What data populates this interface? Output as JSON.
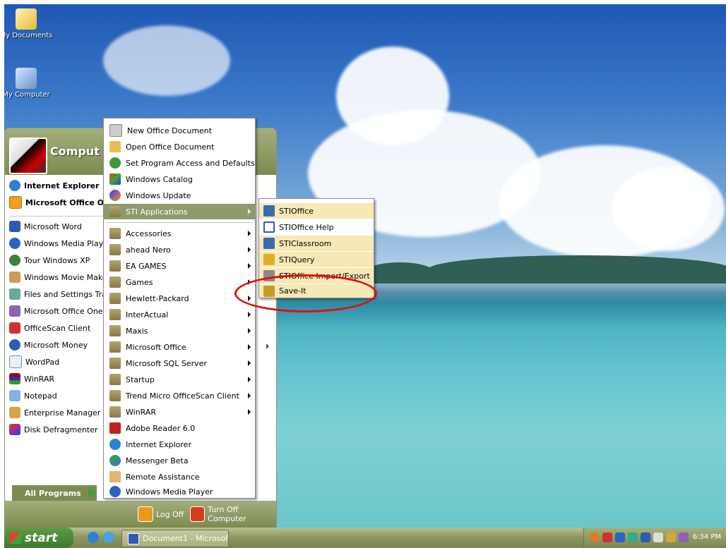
{
  "desktop": {
    "icons": [
      {
        "label": "My Documents",
        "icon": "folder-documents-icon"
      },
      {
        "label": "My Computer",
        "icon": "computer-icon"
      }
    ]
  },
  "start_menu": {
    "user_name": "Comput",
    "pinned": [
      {
        "label": "Internet Explorer",
        "icon": "internet-explorer-icon"
      },
      {
        "label": "Microsoft Office O",
        "icon": "office-icon"
      }
    ],
    "recent": [
      {
        "label": "Microsoft Word",
        "icon": "word-icon"
      },
      {
        "label": "Windows Media Playe",
        "icon": "media-player-icon"
      },
      {
        "label": "Tour Windows XP",
        "icon": "tour-icon"
      },
      {
        "label": "Windows Movie Make",
        "icon": "movie-maker-icon"
      },
      {
        "label": "Files and Settings Tra",
        "icon": "transfer-icon"
      },
      {
        "label": "Microsoft Office One",
        "icon": "onenote-icon"
      },
      {
        "label": "OfficeScan Client",
        "icon": "officescan-icon"
      },
      {
        "label": "Microsoft Money",
        "icon": "money-icon"
      },
      {
        "label": "WordPad",
        "icon": "wordpad-icon"
      },
      {
        "label": "WinRAR",
        "icon": "winrar-icon"
      },
      {
        "label": "Notepad",
        "icon": "notepad-icon"
      },
      {
        "label": "Enterprise Manager",
        "icon": "enterprise-manager-icon"
      },
      {
        "label": "Disk Defragmenter",
        "icon": "defrag-icon"
      }
    ],
    "all_programs": "All Programs",
    "log_off": "Log Off",
    "turn_off": "Turn Off Computer"
  },
  "programs_menu": {
    "top_items": [
      {
        "label": "New Office Document"
      },
      {
        "label": "Open Office Document"
      },
      {
        "label": "Set Program Access and Defaults"
      },
      {
        "label": "Windows Catalog"
      },
      {
        "label": "Windows Update"
      },
      {
        "label": "STI Applications",
        "submenu": true,
        "selected": true
      }
    ],
    "items": [
      {
        "label": "Accessories",
        "submenu": true
      },
      {
        "label": "ahead Nero",
        "submenu": true
      },
      {
        "label": "EA GAMES",
        "submenu": true
      },
      {
        "label": "Games",
        "submenu": true
      },
      {
        "label": "Hewlett-Packard",
        "submenu": true
      },
      {
        "label": "InterActual",
        "submenu": true
      },
      {
        "label": "Maxis",
        "submenu": true
      },
      {
        "label": "Microsoft Office",
        "submenu": true
      },
      {
        "label": "Microsoft SQL Server",
        "submenu": true
      },
      {
        "label": "Startup",
        "submenu": true
      },
      {
        "label": "Trend Micro OfficeScan Client",
        "submenu": true
      },
      {
        "label": "WinRAR",
        "submenu": true
      },
      {
        "label": "Adobe Reader 6.0"
      },
      {
        "label": "Internet Explorer"
      },
      {
        "label": "Messenger Beta"
      },
      {
        "label": "Remote Assistance"
      },
      {
        "label": "Windows Media Player"
      }
    ]
  },
  "sti_menu": {
    "items": [
      {
        "label": "STIOffice"
      },
      {
        "label": "STIOffice Help"
      },
      {
        "label": "STIClassroom"
      },
      {
        "label": "STIQuery"
      },
      {
        "label": "STIOffice Import/Export"
      },
      {
        "label": "Save-It"
      }
    ]
  },
  "taskbar": {
    "start_label": "start",
    "task_label": "Document1 - Microsof...",
    "clock": "6:34 PM"
  }
}
